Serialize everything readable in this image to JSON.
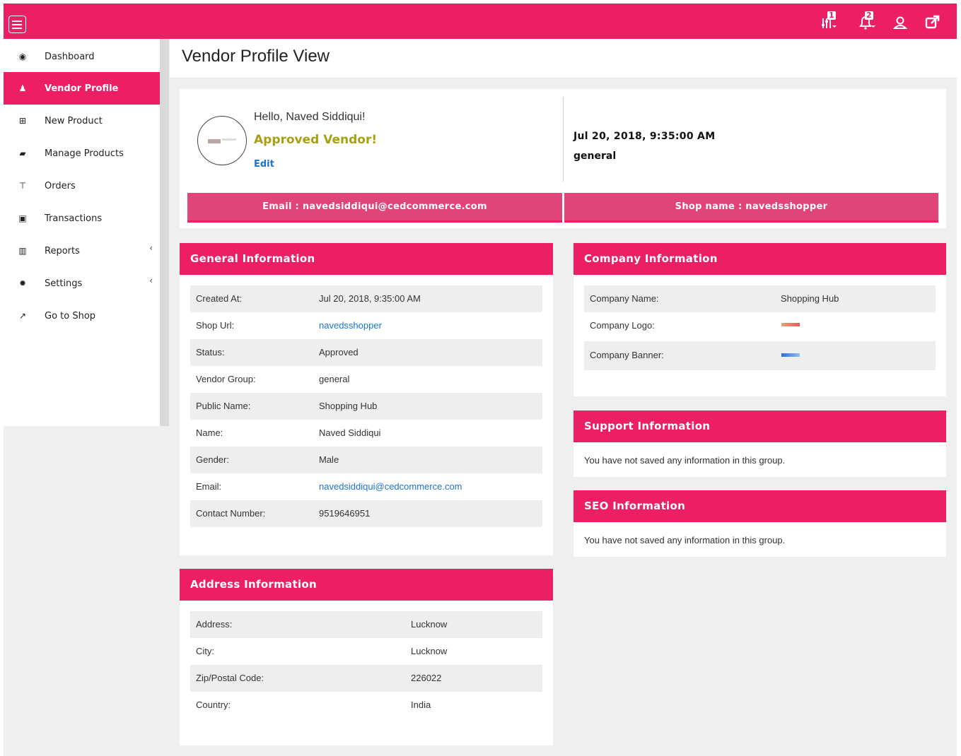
{
  "header": {
    "menu_icon": "hamburger-icon",
    "icons": [
      {
        "name": "sliders-icon",
        "badge": "1"
      },
      {
        "name": "bell-icon",
        "badge": "2"
      },
      {
        "name": "user-icon",
        "badge": ""
      },
      {
        "name": "external-link-icon",
        "badge": ""
      }
    ],
    "brand_color": "#ec1f65"
  },
  "sidebar": {
    "items": [
      {
        "label": "Dashboard",
        "icon": "dashboard-icon",
        "active": false
      },
      {
        "label": "Vendor Profile",
        "icon": "user-icon",
        "active": true
      },
      {
        "label": "New Product",
        "icon": "plus-square-icon",
        "active": false
      },
      {
        "label": "Manage Products",
        "icon": "folder-icon",
        "active": false
      },
      {
        "label": "Orders",
        "icon": "cart-icon",
        "active": false
      },
      {
        "label": "Transactions",
        "icon": "money-icon",
        "active": false
      },
      {
        "label": "Reports",
        "icon": "bar-chart-icon",
        "active": false,
        "arrow": "‹"
      },
      {
        "label": "Settings",
        "icon": "gear-icon",
        "active": false,
        "arrow": "‹"
      },
      {
        "label": "Go to Shop",
        "icon": "external-link-icon",
        "active": false
      }
    ]
  },
  "page": {
    "title": "Vendor Profile View"
  },
  "profile": {
    "hello": "Hello, Naved Siddiqui!",
    "status": "Approved Vendor!",
    "edit_label": "Edit",
    "date": "Jul 20, 2018, 9:35:00 AM",
    "group": "general",
    "email_bar": "Email : navedsiddiqui@cedcommerce.com",
    "shop_bar": "Shop name : navedsshopper"
  },
  "general": {
    "title": "General Information",
    "rows": [
      {
        "label": "Created At:",
        "value": "Jul 20, 2018, 9:35:00 AM"
      },
      {
        "label": "Shop Url:",
        "value": "navedsshopper"
      },
      {
        "label": "Status:",
        "value": "Approved"
      },
      {
        "label": "Vendor Group:",
        "value": "general"
      },
      {
        "label": "Public Name:",
        "value": "Shopping Hub"
      },
      {
        "label": "Name:",
        "value": "Naved Siddiqui"
      },
      {
        "label": "Gender:",
        "value": "Male"
      },
      {
        "label": "Email:",
        "value": "navedsiddiqui@cedcommerce.com"
      },
      {
        "label": "Contact Number:",
        "value": "9519646951"
      }
    ]
  },
  "address": {
    "title": "Address Information",
    "rows": [
      {
        "label": "Address:",
        "value": "Lucknow"
      },
      {
        "label": "City:",
        "value": "Lucknow"
      },
      {
        "label": "Zip/Postal Code:",
        "value": "226022"
      },
      {
        "label": "Country:",
        "value": "India"
      }
    ]
  },
  "company": {
    "title": "Company Information",
    "rows": [
      {
        "label": "Company Name:",
        "value": "Shopping Hub"
      },
      {
        "label": "Company Logo:",
        "value": ""
      },
      {
        "label": "Company Banner:",
        "value": ""
      }
    ]
  },
  "support": {
    "title": "Support Information",
    "note": "You have not saved any information in this group."
  },
  "seo": {
    "title": "SEO Information",
    "note": "You have not saved any information in this group."
  }
}
